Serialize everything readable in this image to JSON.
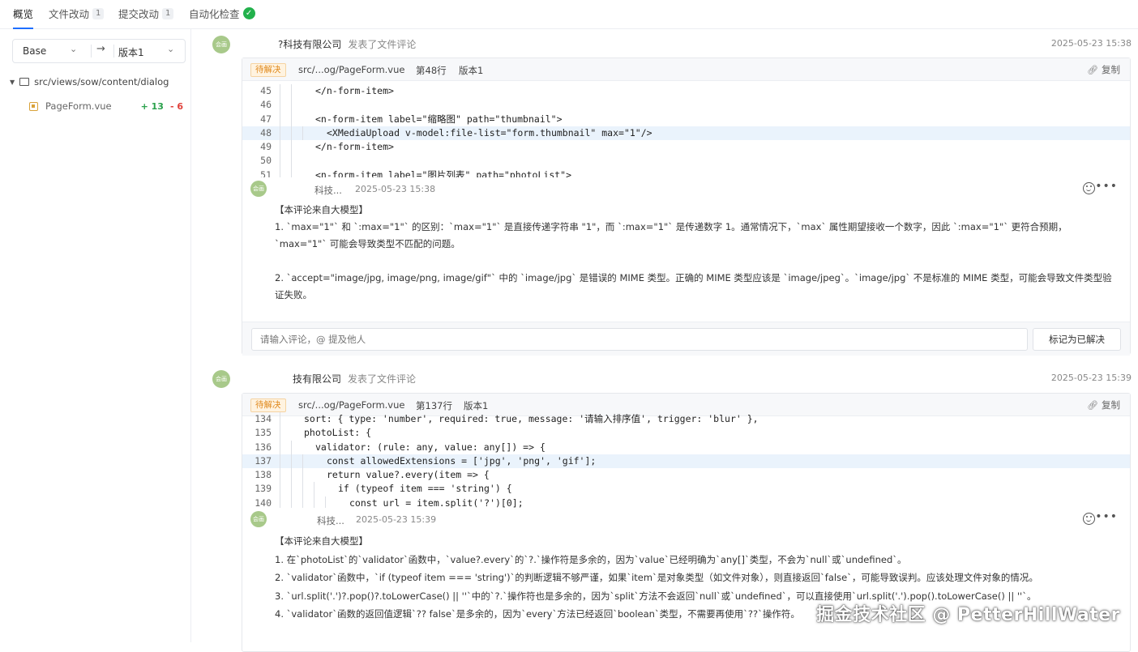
{
  "tabs": [
    {
      "label": "概览",
      "count": ""
    },
    {
      "label": "文件改动",
      "count": "1"
    },
    {
      "label": "提交改动",
      "count": "1"
    },
    {
      "label": "自动化检查",
      "count": ""
    }
  ],
  "sidebar": {
    "base_label": "Base",
    "version_label": "版本1",
    "folder": "src/views/sow/content/dialog",
    "file": {
      "name": "PageForm.vue",
      "adds": "+ 13",
      "dels": "- 6"
    }
  },
  "events": [
    {
      "author": "?科技有限公司",
      "action": "发表了文件评论",
      "time": "2025-05-23 15:38",
      "status": "待解决",
      "path": "src/...og/PageForm.vue",
      "line": "第48行",
      "version": "版本1",
      "copy": "复制",
      "code": [
        {
          "n": "45",
          "t": "</n-form-item>",
          "indent": 2,
          "hl": false
        },
        {
          "n": "46",
          "t": "",
          "indent": 2,
          "hl": false
        },
        {
          "n": "47",
          "t": "<n-form-item label=\"缩略图\" path=\"thumbnail\">",
          "indent": 2,
          "hl": false
        },
        {
          "n": "48",
          "t": "<XMediaUpload v-model:file-list=\"form.thumbnail\" max=\"1\"/>",
          "indent": 3,
          "hl": true
        },
        {
          "n": "49",
          "t": "</n-form-item>",
          "indent": 2,
          "hl": false
        },
        {
          "n": "50",
          "t": "",
          "indent": 2,
          "hl": false
        },
        {
          "n": "51",
          "t": "<n-form-item label=\"图片列表\" path=\"photoList\">",
          "indent": 2,
          "hl": false
        }
      ],
      "comment": {
        "author": "科技...",
        "time": "2025-05-23 15:38",
        "paragraphs": [
          "【本评论来自大模型】",
          "1. `max=\"1\"` 和 `:max=\"1\"` 的区别：`max=\"1\"` 是直接传递字符串 \"1\"，而 `:max=\"1\"` 是传递数字 1。通常情况下，`max` 属性期望接收一个数字，因此 `:max=\"1\"` 更符合预期，`max=\"1\"` 可能会导致类型不匹配的问题。",
          "",
          "2. `accept=\"image/jpg, image/png, image/gif\"` 中的 `image/jpg` 是错误的 MIME 类型。正确的 MIME 类型应该是 `image/jpeg`。`image/jpg` 不是标准的 MIME 类型，可能会导致文件类型验证失败。"
        ]
      },
      "reply_placeholder": "请输入评论，@ 提及他人",
      "resolve_label": "标记为已解决"
    },
    {
      "author": "技有限公司",
      "action": "发表了文件评论",
      "time": "2025-05-23 15:39",
      "status": "待解决",
      "path": "src/...og/PageForm.vue",
      "line": "第137行",
      "version": "版本1",
      "copy": "复制",
      "code": [
        {
          "n": "134",
          "t": "sort: { type: 'number', required: true, message: '请输入排序值', trigger: 'blur' },",
          "indent": 1,
          "hl": false
        },
        {
          "n": "135",
          "t": "photoList: {",
          "indent": 1,
          "hl": false
        },
        {
          "n": "136",
          "t": "validator: (rule: any, value: any[]) => {",
          "indent": 2,
          "hl": false
        },
        {
          "n": "137",
          "t": "const allowedExtensions = ['jpg', 'png', 'gif'];",
          "indent": 3,
          "hl": true
        },
        {
          "n": "138",
          "t": "return value?.every(item => {",
          "indent": 3,
          "hl": false
        },
        {
          "n": "139",
          "t": "if (typeof item === 'string') {",
          "indent": 4,
          "hl": false
        },
        {
          "n": "140",
          "t": "const url = item.split('?')[0];",
          "indent": 5,
          "hl": false
        }
      ],
      "comment": {
        "author": "科技...",
        "time": "2025-05-23 15:39",
        "paragraphs": [
          "【本评论来自大模型】",
          "1. 在`photoList`的`validator`函数中，`value?.every`的`?.`操作符是多余的，因为`value`已经明确为`any[]`类型，不会为`null`或`undefined`。",
          "2. `validator`函数中，`if (typeof item === 'string')`的判断逻辑不够严谨，如果`item`是对象类型（如文件对象），则直接返回`false`，可能导致误判。应该处理文件对象的情况。",
          "3. `url.split('.')?.pop()?.toLowerCase() || ''`中的`?.`操作符也是多余的，因为`split`方法不会返回`null`或`undefined`，可以直接使用`url.split('.').pop().toLowerCase() || ''`。",
          "4. `validator`函数的返回值逻辑`?? false`是多余的，因为`every`方法已经返回`boolean`类型，不需要再使用`??`操作符。"
        ]
      }
    }
  ],
  "avatar_text": "会画",
  "watermark": "掘金技术社区 @ PetterHillWater"
}
